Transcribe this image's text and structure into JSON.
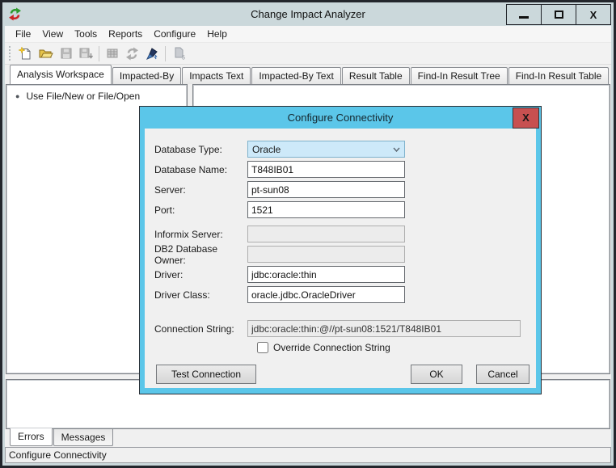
{
  "window": {
    "title": "Change Impact Analyzer",
    "close_glyph": "X"
  },
  "menubar": {
    "items": [
      "File",
      "View",
      "Tools",
      "Reports",
      "Configure",
      "Help"
    ]
  },
  "toolbar": {
    "buttons": [
      {
        "icon": "new-file-icon",
        "enabled": true
      },
      {
        "icon": "open-folder-icon",
        "enabled": true
      },
      {
        "icon": "save-icon",
        "enabled": false
      },
      {
        "icon": "save-as-icon",
        "enabled": false
      },
      {
        "icon": "table-icon",
        "enabled": false
      },
      {
        "icon": "refresh-icon",
        "enabled": false
      },
      {
        "icon": "run-analysis-icon",
        "enabled": true
      },
      {
        "icon": "report-icon",
        "enabled": false
      }
    ]
  },
  "tabs": {
    "active": "Analysis Workspace",
    "items": [
      "Analysis Workspace",
      "Impacted-By",
      "Impacts Text",
      "Impacted-By Text",
      "Result Table",
      "Find-In Result Tree",
      "Find-In Result Table"
    ]
  },
  "workspace": {
    "tree_items": [
      "Use File/New or File/Open"
    ]
  },
  "bottom_tabs": {
    "active": "Errors",
    "items": [
      "Errors",
      "Messages"
    ]
  },
  "statusbar": {
    "text": "Configure Connectivity"
  },
  "dialog": {
    "title": "Configure Connectivity",
    "close_glyph": "X",
    "fields": [
      {
        "label": "Database Type:",
        "value": "Oracle",
        "type": "combobox",
        "enabled": true
      },
      {
        "label": "Database Name:",
        "value": "T848IB01",
        "type": "text",
        "enabled": true
      },
      {
        "label": "Server:",
        "value": "pt-sun08",
        "type": "text",
        "enabled": true
      },
      {
        "label": "Port:",
        "value": "1521",
        "type": "text",
        "enabled": true
      },
      {
        "label": "Informix Server:",
        "value": "",
        "type": "text",
        "enabled": false
      },
      {
        "label": "DB2 Database Owner:",
        "value": "",
        "type": "text",
        "enabled": false
      },
      {
        "label": "Driver:",
        "value": "jdbc:oracle:thin",
        "type": "text",
        "enabled": true
      },
      {
        "label": "Driver Class:",
        "value": "oracle.jdbc.OracleDriver",
        "type": "text",
        "enabled": true
      },
      {
        "label": "Connection String:",
        "value": "jdbc:oracle:thin:@//pt-sun08:1521/T848IB01",
        "type": "text",
        "enabled": false
      }
    ],
    "checkbox": {
      "label": "Override Connection String",
      "checked": false
    },
    "buttons": {
      "test": "Test Connection",
      "ok": "OK",
      "cancel": "Cancel"
    }
  },
  "colors": {
    "dialog_accent": "#5bc6e9",
    "close_button_red": "#c75050",
    "combo_highlight": "#cde9f9",
    "titlebar": "#cbd8db",
    "window_border": "#23262c"
  }
}
